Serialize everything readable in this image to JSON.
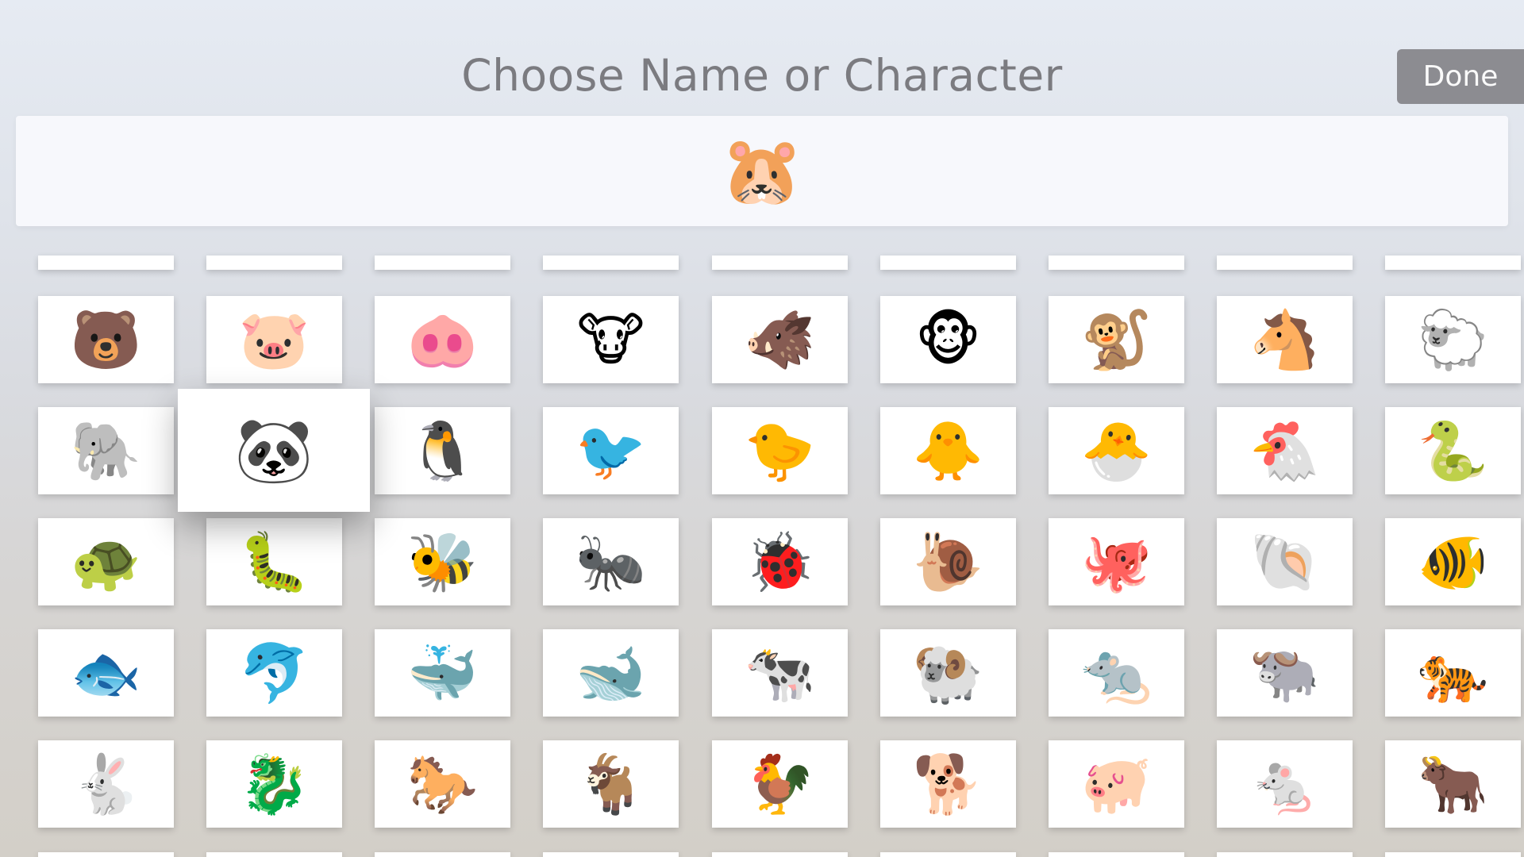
{
  "header": {
    "title": "Choose Name or Character",
    "done_label": "Done"
  },
  "entry": {
    "selected_character": "🐹"
  },
  "grid": {
    "focused_item": "🐼",
    "rows": [
      [
        "🐻",
        "🐷",
        "🐽",
        "🐮",
        "🐗",
        "🐵",
        "🐒",
        "🐴",
        "🐑"
      ],
      [
        "🐘",
        "🐼",
        "🐧",
        "🐦",
        "🐤",
        "🐥",
        "🐣",
        "🐔",
        "🐍"
      ],
      [
        "🐢",
        "🐛",
        "🐝",
        "🐜",
        "🐞",
        "🐌",
        "🐙",
        "🐚",
        "🐠"
      ],
      [
        "🐟",
        "🐬",
        "🐳",
        "🐋",
        "🐄",
        "🐏",
        "🐀",
        "🐃",
        "🐅"
      ],
      [
        "🐇",
        "🐉",
        "🐎",
        "🐐",
        "🐓",
        "🐕",
        "🐖",
        "🐁",
        "🐂"
      ]
    ]
  }
}
